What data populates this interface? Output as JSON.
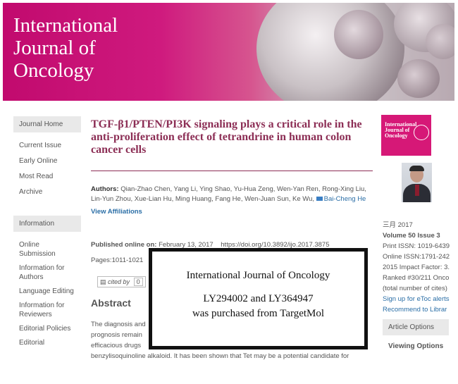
{
  "banner": {
    "journal_title_line1": "International",
    "journal_title_line2": "Journal of",
    "journal_title_line3": "Oncology"
  },
  "sidebar": {
    "journal_home": "Journal Home",
    "nav_items": [
      "Current Issue",
      "Early Online",
      "Most Read",
      "Archive"
    ],
    "information": "Information",
    "info_items": [
      "Online Submission",
      "Information for Authors",
      "Language Editing",
      "Information for Reviewers",
      "Editorial Policies",
      "Editorial"
    ]
  },
  "article": {
    "title": "TGF-β1/PTEN/PI3K signaling plays a critical role in the anti-proliferation effect of tetrandrine in human colon cancer cells",
    "authors_label": "Authors:",
    "authors": "Qian-Zhao Chen, Yang Li, Ying Shao, Yu-Hua Zeng, Wen-Yan Ren, Rong-Xing Liu, Lin-Yun Zhou, Xue-Lian Hu, Ming Huang, Fang He, Wen-Juan Sun, Ke Wu,",
    "last_author": "Bai-Cheng He",
    "view_affiliations": "View Affiliations",
    "published_label": "Published online on:",
    "published_date": "February 13, 2017",
    "doi": "https://doi.org/10.3892/ijo.2017.3875",
    "pages": "Pages:1011-1021",
    "cited_by": "cited by",
    "cited_count": "0",
    "abstract_heading": "Abstract",
    "abstract_lines": [
      "The diagnosis and",
      "prognosis remain",
      "efficacious drugs",
      "benzylisoquinoline alkaloid. It has been shown that Tet may be a potential candidate for"
    ]
  },
  "overlay": {
    "line1": "International Journal of Oncology",
    "line2": "LY294002 and LY364947",
    "line3": "was purchased from TargetMol"
  },
  "right_panel": {
    "cover_title": "International Journal of Oncology",
    "issue_date": "三月 2017",
    "volume": "Volume 50 Issue 3",
    "print_issn": "Print ISSN: 1019-6439",
    "online_issn": "Online ISSN:1791-242",
    "impact_factor": "2015 Impact Factor: 3.",
    "ranked": "Ranked #30/211 Onco",
    "cites_note": "(total number of cites)",
    "etoc": "Sign up for eToc alerts",
    "recommend": "Recommend to Librar",
    "article_options": "Article Options",
    "viewing_options": "Viewing Options"
  },
  "colors": {
    "brand_magenta": "#c10a6e",
    "title_color": "#8c2e55",
    "link_blue": "#2a6ea6"
  }
}
